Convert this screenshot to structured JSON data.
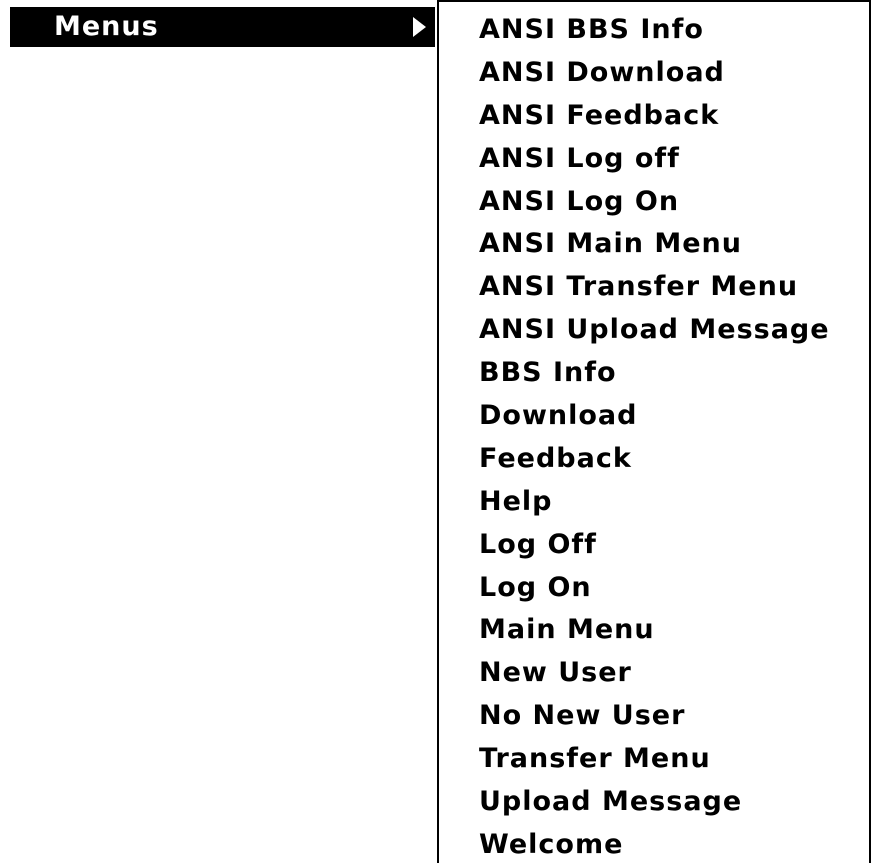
{
  "parent_menu": {
    "label": "Menus",
    "arrow_icon": "submenu-arrow-icon"
  },
  "submenu": {
    "items": [
      {
        "label": "ANSI BBS Info"
      },
      {
        "label": "ANSI Download"
      },
      {
        "label": "ANSI Feedback"
      },
      {
        "label": "ANSI Log off"
      },
      {
        "label": "ANSI Log On"
      },
      {
        "label": "ANSI Main Menu"
      },
      {
        "label": "ANSI Transfer Menu"
      },
      {
        "label": "ANSI Upload Message"
      },
      {
        "label": "BBS Info"
      },
      {
        "label": "Download"
      },
      {
        "label": "Feedback"
      },
      {
        "label": "Help"
      },
      {
        "label": "Log Off"
      },
      {
        "label": "Log On"
      },
      {
        "label": "Main Menu"
      },
      {
        "label": "New User"
      },
      {
        "label": "No New User"
      },
      {
        "label": "Transfer Menu"
      },
      {
        "label": "Upload Message"
      },
      {
        "label": "Welcome"
      }
    ]
  },
  "colors": {
    "highlight_background": "#000000",
    "highlight_text": "#ffffff",
    "menu_background": "#ffffff",
    "menu_text": "#000000"
  }
}
